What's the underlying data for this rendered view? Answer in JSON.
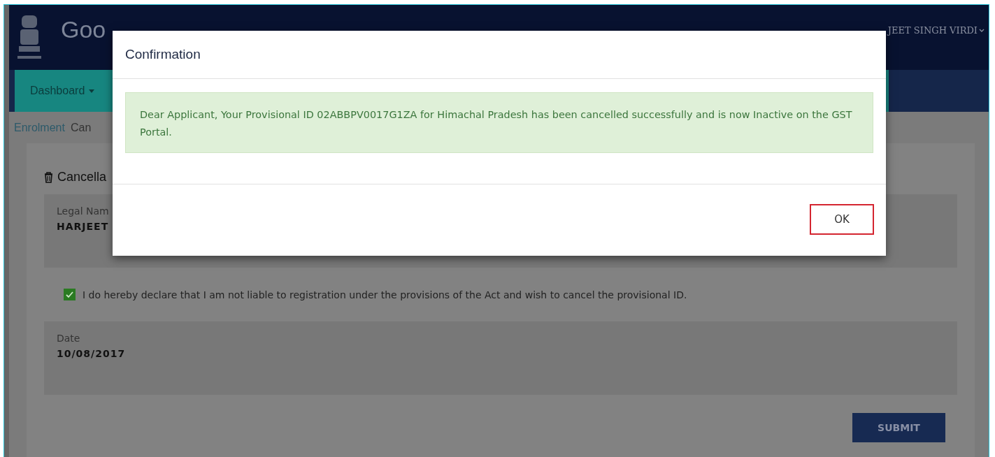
{
  "header": {
    "title": "Goo",
    "user": "JEET SINGH VIRDI"
  },
  "nav": {
    "label": "Dashboard"
  },
  "breadcrumb": [
    "Enrolment",
    "Can"
  ],
  "form": {
    "heading": "Cancella",
    "legal_name_label": "Legal Nam",
    "legal_name_value": "HARJEET",
    "declaration": {
      "checked": true,
      "text": "I do hereby declare that I am not liable to registration under the provisions of the Act and wish to cancel the provisional ID."
    },
    "date_label": "Date",
    "date_value": "10/08/2017",
    "submit": "SUBMIT"
  },
  "modal": {
    "title": "Confirmation",
    "message": "Dear Applicant, Your Provisional ID 02ABBPV0017G1ZA for Himachal Pradesh has been cancelled successfully and is now Inactive on the GST Portal.",
    "ok": "OK"
  }
}
